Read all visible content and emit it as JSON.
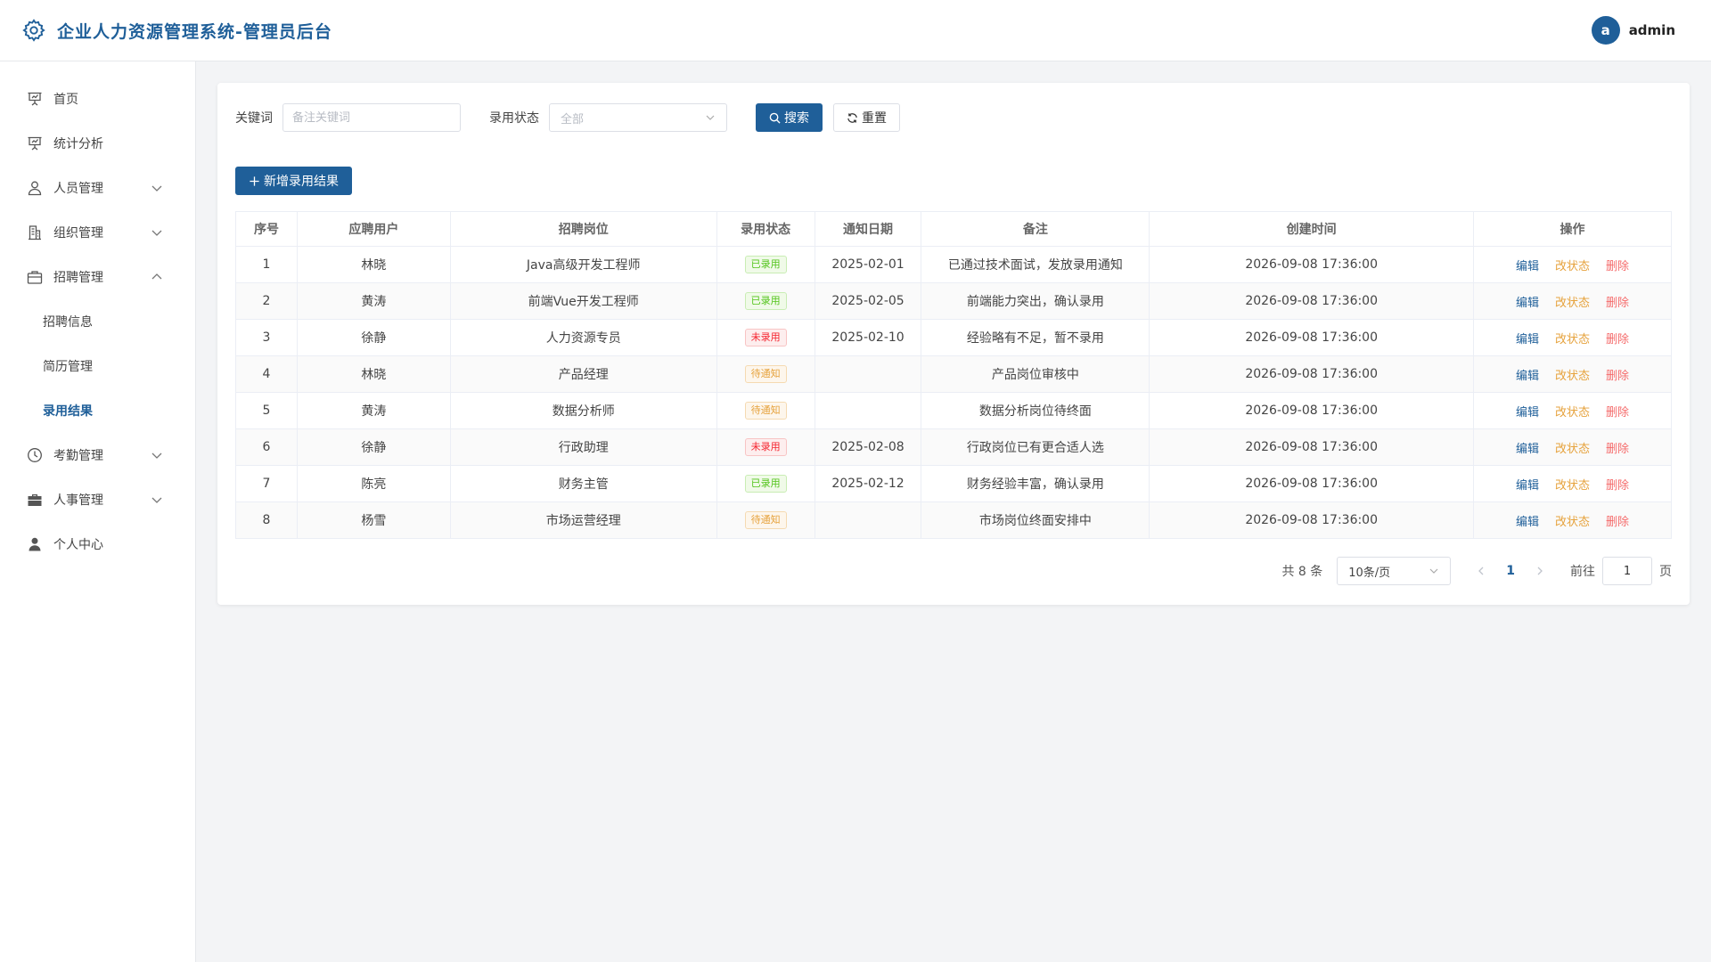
{
  "header": {
    "title": "企业人力资源管理系统-管理员后台",
    "avatar_letter": "a",
    "username": "admin",
    "brand_color": "#1f5f99"
  },
  "sidebar": {
    "items": [
      {
        "label": "首页",
        "icon": "presentation-icon"
      },
      {
        "label": "统计分析",
        "icon": "presentation-icon"
      },
      {
        "label": "人员管理",
        "icon": "user-icon"
      },
      {
        "label": "组织管理",
        "icon": "office-building-icon"
      },
      {
        "label": "招聘管理",
        "icon": "briefcase-icon"
      },
      {
        "label": "考勤管理",
        "icon": "clock-icon"
      },
      {
        "label": "人事管理",
        "icon": "suitcase-icon"
      },
      {
        "label": "个人中心",
        "icon": "user-filled-icon"
      }
    ],
    "recruit_sub": [
      "招聘信息",
      "简历管理",
      "录用结果"
    ],
    "active_sub": "录用结果"
  },
  "filter": {
    "keyword_label": "关键词",
    "keyword_placeholder": "备注关键词",
    "keyword_value": "",
    "status_label": "录用状态",
    "status_value": "全部",
    "search_label": "搜索",
    "reset_label": "重置"
  },
  "add_label": "新增录用结果",
  "table": {
    "columns": [
      "序号",
      "应聘用户",
      "招聘岗位",
      "录用状态",
      "通知日期",
      "备注",
      "创建时间",
      "操作"
    ],
    "ops": {
      "edit": "编辑",
      "status": "改状态",
      "delete": "删除"
    },
    "rows": [
      {
        "no": "1",
        "user": "林晓",
        "position": "Java高级开发工程师",
        "status": "已录用",
        "status_color": "green",
        "date": "2025-02-01",
        "note": "已通过技术面试，发放录用通知",
        "created": "2026-09-08 17:36:00"
      },
      {
        "no": "2",
        "user": "黄涛",
        "position": "前端Vue开发工程师",
        "status": "已录用",
        "status_color": "green",
        "date": "2025-02-05",
        "note": "前端能力突出，确认录用",
        "created": "2026-09-08 17:36:00"
      },
      {
        "no": "3",
        "user": "徐静",
        "position": "人力资源专员",
        "status": "未录用",
        "status_color": "red",
        "date": "2025-02-10",
        "note": "经验略有不足，暂不录用",
        "created": "2026-09-08 17:36:00"
      },
      {
        "no": "4",
        "user": "林晓",
        "position": "产品经理",
        "status": "待通知",
        "status_color": "orange",
        "date": "",
        "note": "产品岗位审核中",
        "created": "2026-09-08 17:36:00"
      },
      {
        "no": "5",
        "user": "黄涛",
        "position": "数据分析师",
        "status": "待通知",
        "status_color": "orange",
        "date": "",
        "note": "数据分析岗位待终面",
        "created": "2026-09-08 17:36:00"
      },
      {
        "no": "6",
        "user": "徐静",
        "position": "行政助理",
        "status": "未录用",
        "status_color": "red",
        "date": "2025-02-08",
        "note": "行政岗位已有更合适人选",
        "created": "2026-09-08 17:36:00"
      },
      {
        "no": "7",
        "user": "陈亮",
        "position": "财务主管",
        "status": "已录用",
        "status_color": "green",
        "date": "2025-02-12",
        "note": "财务经验丰富，确认录用",
        "created": "2026-09-08 17:36:00"
      },
      {
        "no": "8",
        "user": "杨雪",
        "position": "市场运营经理",
        "status": "待通知",
        "status_color": "orange",
        "date": "",
        "note": "市场岗位终面安排中",
        "created": "2026-09-08 17:36:00"
      }
    ]
  },
  "pagination": {
    "total_text": "共 8 条",
    "page_size": "10条/页",
    "current_page": "1",
    "goto_label": "前往",
    "goto_value": "1",
    "page_suffix": "页"
  }
}
